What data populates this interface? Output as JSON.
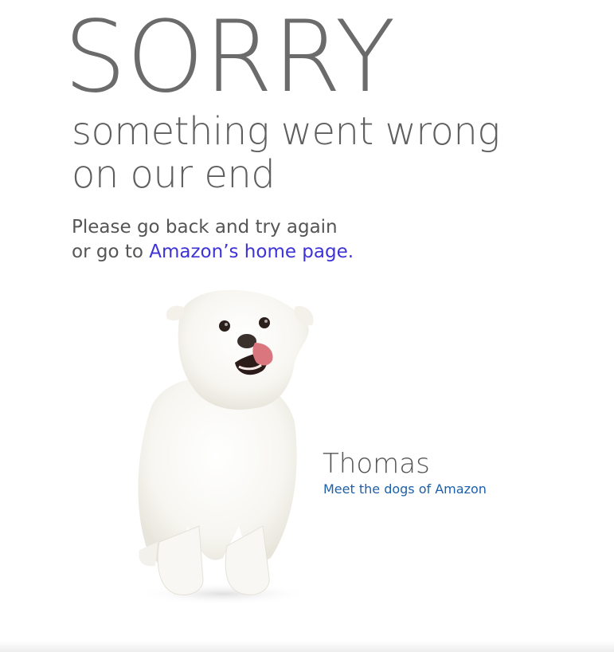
{
  "error": {
    "headline": "SORRY",
    "subline_1": "something went wrong",
    "subline_2": "on our end",
    "message_line_1": "Please go back and try again",
    "message_prefix": "or go to ",
    "home_link_label": "Amazon’s home page."
  },
  "dog": {
    "name": "Thomas",
    "link_label": "Meet the dogs of Amazon",
    "illustration": "white-dog-licking-nose"
  },
  "colors": {
    "headline": "#6b6b6b",
    "link_home": "#3d33d6",
    "link_dogs": "#1d5fa8"
  }
}
